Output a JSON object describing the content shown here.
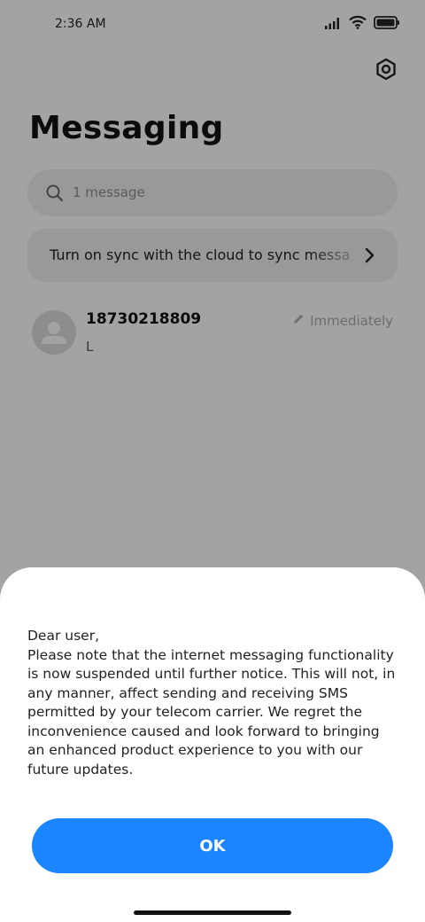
{
  "status_bar": {
    "time": "2:36 AM",
    "icons": [
      "signal-icon",
      "wifi-icon",
      "battery-icon"
    ]
  },
  "header": {
    "title": "Messaging",
    "settings_icon": "settings-icon"
  },
  "search": {
    "placeholder": "1 message"
  },
  "sync_banner": {
    "text": "Turn on sync with the cloud to sync messages"
  },
  "conversations": [
    {
      "name": "18730218809",
      "snippet": "L",
      "time": "Immediately",
      "status_icon": "pencil-icon"
    }
  ],
  "dialog": {
    "message": "Dear user,\nPlease note that the internet messaging functionality is now suspended until further notice. This will not, in any manner, affect sending and receiving SMS permitted by your telecom carrier. We regret the inconvenience caused and look forward to bringing an enhanced product experience to you with our future updates.",
    "ok_label": "OK"
  },
  "colors": {
    "accent": "#1a85ff",
    "background": "#fafafa",
    "overlay": "rgba(0,0,0,0.35)"
  }
}
